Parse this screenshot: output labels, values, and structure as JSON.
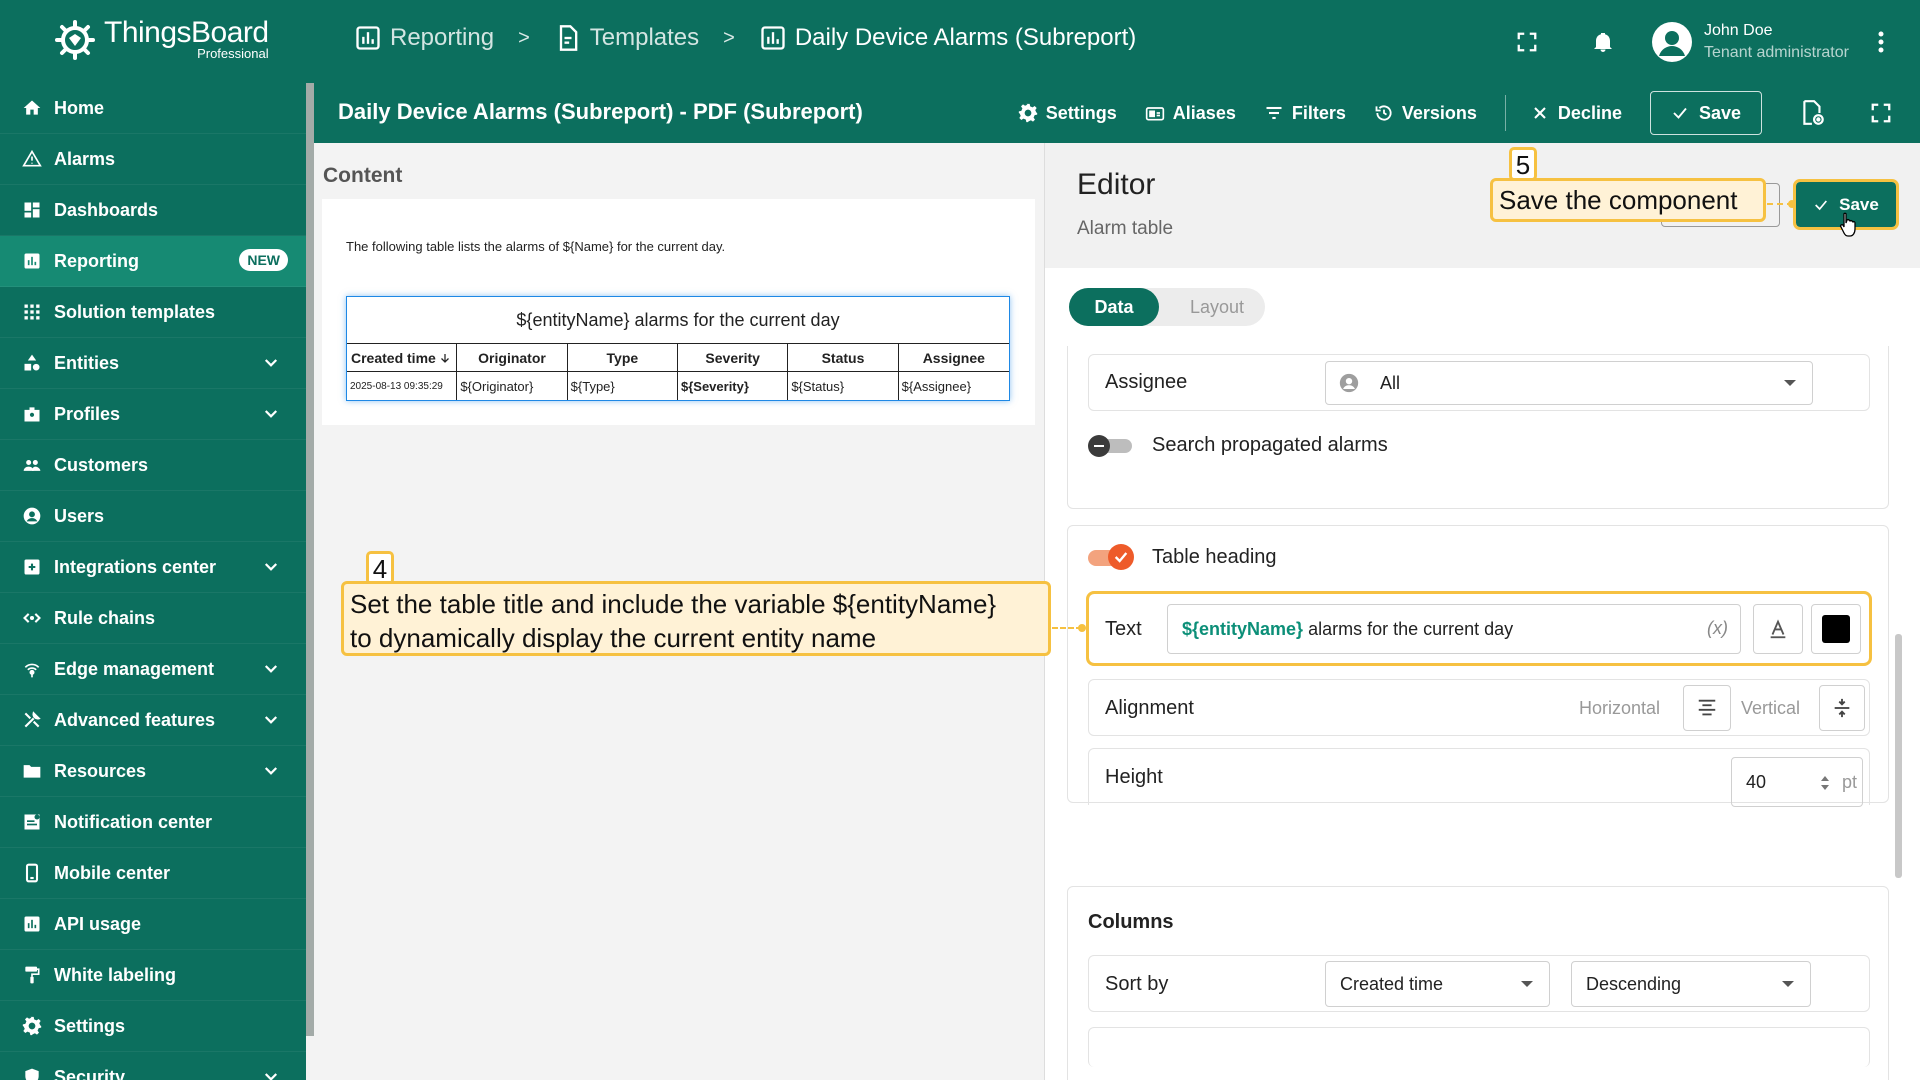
{
  "app": {
    "name": "ThingsBoard",
    "edition": "Professional"
  },
  "breadcrumb": [
    {
      "label": "Reporting",
      "icon": "reporting-icon"
    },
    {
      "label": "Templates",
      "icon": "template-icon"
    },
    {
      "label": "Daily Device Alarms (Subreport)",
      "icon": "report-icon"
    }
  ],
  "breadcrumb_separator": ">",
  "user": {
    "name": "John Doe",
    "role": "Tenant administrator"
  },
  "sidebar": {
    "items": [
      {
        "label": "Home",
        "icon": "home-icon",
        "expandable": false
      },
      {
        "label": "Alarms",
        "icon": "alarm-icon",
        "expandable": false
      },
      {
        "label": "Dashboards",
        "icon": "dashboard-icon",
        "expandable": false
      },
      {
        "label": "Reporting",
        "icon": "reporting-icon",
        "expandable": false,
        "active": true,
        "badge": "NEW"
      },
      {
        "label": "Solution templates",
        "icon": "apps-icon",
        "expandable": false
      },
      {
        "label": "Entities",
        "icon": "entities-icon",
        "expandable": true
      },
      {
        "label": "Profiles",
        "icon": "profiles-icon",
        "expandable": true
      },
      {
        "label": "Customers",
        "icon": "customers-icon",
        "expandable": false
      },
      {
        "label": "Users",
        "icon": "user-icon",
        "expandable": false
      },
      {
        "label": "Integrations center",
        "icon": "integrations-icon",
        "expandable": true
      },
      {
        "label": "Rule chains",
        "icon": "rule-chain-icon",
        "expandable": false
      },
      {
        "label": "Edge management",
        "icon": "edge-icon",
        "expandable": true
      },
      {
        "label": "Advanced features",
        "icon": "tools-icon",
        "expandable": true
      },
      {
        "label": "Resources",
        "icon": "folder-icon",
        "expandable": true
      },
      {
        "label": "Notification center",
        "icon": "notification-icon",
        "expandable": false
      },
      {
        "label": "Mobile center",
        "icon": "mobile-icon",
        "expandable": false
      },
      {
        "label": "API usage",
        "icon": "api-usage-icon",
        "expandable": false
      },
      {
        "label": "White labeling",
        "icon": "paint-roller-icon",
        "expandable": false
      },
      {
        "label": "Settings",
        "icon": "gear-icon",
        "expandable": false
      },
      {
        "label": "Security",
        "icon": "shield-icon",
        "expandable": true
      }
    ]
  },
  "editor_header": {
    "title": "Daily Device Alarms (Subreport) - PDF (Subreport)",
    "settings": "Settings",
    "aliases": "Aliases",
    "filters": "Filters",
    "versions": "Versions",
    "decline": "Decline",
    "save": "Save"
  },
  "content": {
    "label": "Content",
    "intro": "The following table lists the alarms of ${Name} for the current day.",
    "table": {
      "title": "${entityName} alarms for the current day",
      "headers": [
        "Created time",
        "Originator",
        "Type",
        "Severity",
        "Status",
        "Assignee"
      ],
      "row": [
        "2025-08-13 09:35:29",
        "${Originator}",
        "${Type}",
        "${Severity}",
        "${Status}",
        "${Assignee}"
      ]
    }
  },
  "editor": {
    "title": "Editor",
    "subtitle": "Alarm table",
    "save": "Save",
    "tabs": [
      "Data",
      "Layout"
    ],
    "active_tab": "Data",
    "assignee": {
      "label": "Assignee",
      "value": "All"
    },
    "search_propagated": {
      "label": "Search propagated alarms",
      "enabled": false
    },
    "table_heading": {
      "label": "Table heading",
      "enabled": true,
      "text_label": "Text",
      "text_variable": "${entityName}",
      "text_rest": " alarms for the current day",
      "text_fx": "(x)",
      "text_color": "#000000"
    },
    "alignment": {
      "label": "Alignment",
      "horizontal": "Horizontal",
      "vertical": "Vertical"
    },
    "height": {
      "label": "Height",
      "value": "40",
      "unit": "pt"
    },
    "columns": {
      "label": "Columns",
      "sort_by_label": "Sort by",
      "sort_field": "Created time",
      "sort_order": "Descending"
    }
  },
  "annotations": [
    {
      "number": "4",
      "text_line1": "Set the table title and include the variable ${entityName}",
      "text_line2": "to dynamically display the current entity name"
    },
    {
      "number": "5",
      "text": "Save the component"
    }
  ],
  "colors": {
    "primary": "#0c6f5e",
    "accent": "#ee5b2a",
    "highlight": "#f6c141"
  }
}
